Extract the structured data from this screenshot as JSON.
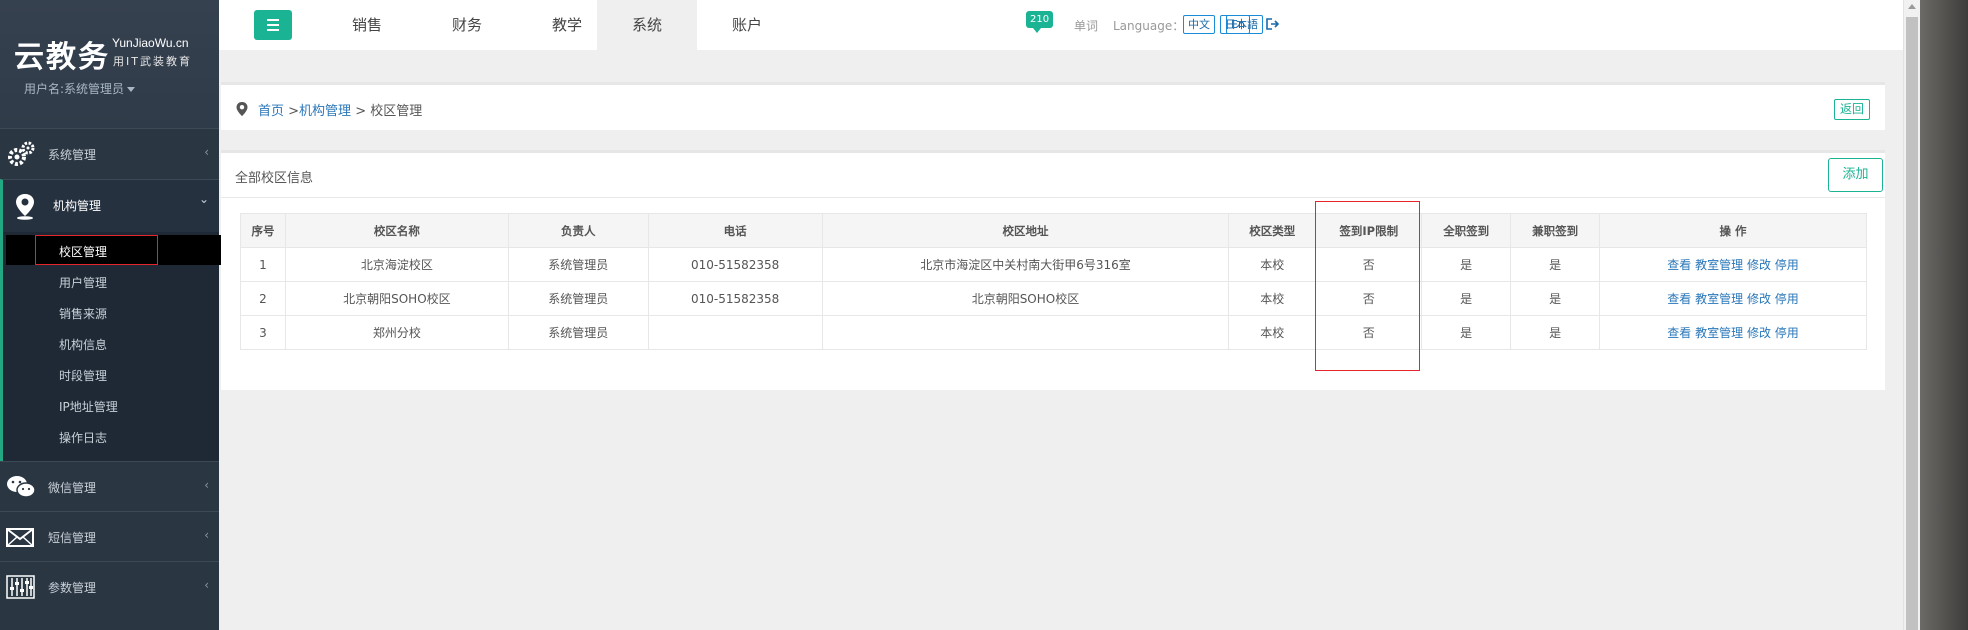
{
  "sidebar": {
    "logo": "云教务",
    "brand_en": "YunJiaoWu.cn",
    "slogan": "用IT武装教育",
    "user": "用户名:系统管理员",
    "groups": [
      {
        "label": "系统管理",
        "icon": "gears-icon",
        "arrow": "‹"
      },
      {
        "label": "机构管理",
        "icon": "location-pin-icon",
        "arrow": "⌄"
      },
      {
        "label": "微信管理",
        "icon": "wechat-icon",
        "arrow": "‹"
      },
      {
        "label": "短信管理",
        "icon": "envelope-icon",
        "arrow": "‹"
      },
      {
        "label": "参数管理",
        "icon": "sliders-icon",
        "arrow": "‹"
      }
    ],
    "sub_items": [
      "校区管理",
      "用户管理",
      "销售来源",
      "机构信息",
      "时段管理",
      "IP地址管理",
      "操作日志"
    ]
  },
  "topbar": {
    "tabs": [
      "销售",
      "财务",
      "教学",
      "系统",
      "账户"
    ],
    "active_tab": "系统",
    "message_count": "210",
    "words": "单词",
    "language_label": "Language：",
    "languages": [
      "中文",
      "En",
      "日本語"
    ]
  },
  "breadcrumb": {
    "home": "首页",
    "sep1": " >",
    "org": "机构管理",
    "sep2": " > 校区管理",
    "back_label": "返回"
  },
  "campus_panel": {
    "title": "全部校区信息",
    "add_label": "添加",
    "columns": [
      "序号",
      "校区名称",
      "负责人",
      "电话",
      "校区地址",
      "校区类型",
      "签到IP限制",
      "全职签到",
      "兼职签到",
      "操 作"
    ],
    "rows": [
      {
        "no": "1",
        "name": "北京海淀校区",
        "manager": "系统管理员",
        "phone": "010-51582358",
        "address": "北京市海淀区中关村南大街甲6号316室",
        "type": "本校",
        "ip_limit": "否",
        "fulltime": "是",
        "parttime": "是"
      },
      {
        "no": "2",
        "name": "北京朝阳SOHO校区",
        "manager": "系统管理员",
        "phone": "010-51582358",
        "address": "北京朝阳SOHO校区",
        "type": "本校",
        "ip_limit": "否",
        "fulltime": "是",
        "parttime": "是"
      },
      {
        "no": "3",
        "name": "郑州分校",
        "manager": "系统管理员",
        "phone": "",
        "address": "",
        "type": "本校",
        "ip_limit": "否",
        "fulltime": "是",
        "parttime": "是"
      }
    ],
    "actions": [
      "查看",
      "教室管理",
      "修改",
      "停用"
    ]
  },
  "colors": {
    "accent": "#1ab394",
    "sidebar_bg": "#2b3643",
    "link": "#2a77b9",
    "highlight": "#e4262a"
  }
}
